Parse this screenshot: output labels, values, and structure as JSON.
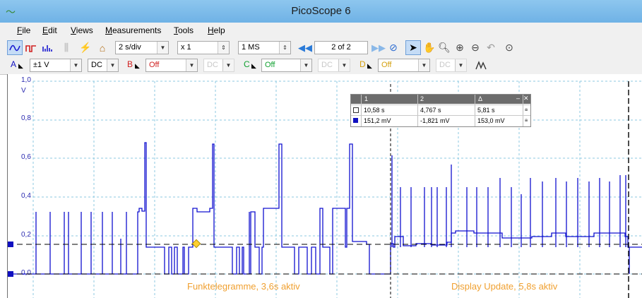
{
  "window": {
    "title": "PicoScope 6"
  },
  "menu": [
    "File",
    "Edit",
    "Views",
    "Measurements",
    "Tools",
    "Help"
  ],
  "toolbar": {
    "timebase": "2 s/div",
    "zoom": "x 1",
    "samples": "1 MS",
    "buffer_page": "2 of 2"
  },
  "channels": [
    {
      "name": "A",
      "range": "±1 V",
      "coupling": "DC",
      "color": "#1010c0"
    },
    {
      "name": "B",
      "range": "Off",
      "coupling": "DC",
      "color": "#d02020"
    },
    {
      "name": "C",
      "range": "Off",
      "coupling": "DC",
      "color": "#10a030"
    },
    {
      "name": "D",
      "range": "Off",
      "coupling": "DC",
      "color": "#d4a010"
    }
  ],
  "axis": {
    "unit": "V",
    "ticks": [
      "1,0",
      "0,8",
      "0,6",
      "0,4",
      "0,2",
      "0,0"
    ]
  },
  "cursors": {
    "columns": [
      "1",
      "2",
      "Δ"
    ],
    "rows": [
      {
        "values": [
          "10,58 s",
          "4,767 s",
          "5,81 s"
        ]
      },
      {
        "values": [
          "151,2 mV",
          "-1,821 mV",
          "153,0 mV"
        ]
      }
    ]
  },
  "annotations": {
    "left": "Funktelegramme, 3,6s aktiv",
    "right": "Display Update, 5,8s aktiv"
  },
  "colors": {
    "trace": "#1010d0",
    "annotation": "#f0a030",
    "titlebar": "#7ab8e8"
  }
}
